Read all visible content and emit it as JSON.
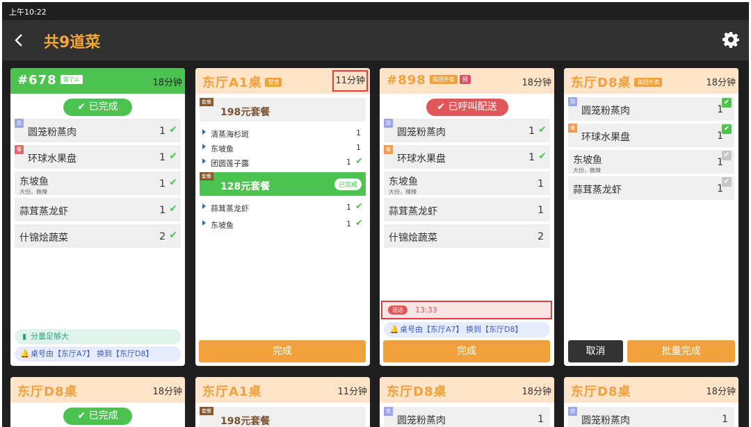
{
  "status_time": "上午10:22",
  "title": "共9道菜",
  "cards": [
    {
      "title": "#678",
      "tag": "饿了么",
      "time": "18分钟",
      "status": "已完成",
      "items": [
        {
          "badge": "追",
          "name": "圆笼粉蒸肉",
          "qty": "1"
        },
        {
          "badge": "催",
          "name": "环球水果盘",
          "qty": "1"
        },
        {
          "name": "东坡鱼",
          "sub": "大份，微辣",
          "qty": "1"
        },
        {
          "name": "蒜茸蒸龙虾",
          "qty": "1"
        },
        {
          "name": "什锦烩蔬菜",
          "qty": "2"
        }
      ],
      "notes": [
        "分量足够大",
        "桌号由【东厅A7】 换到【东厅D8】"
      ]
    },
    {
      "title": "东厅A1桌",
      "tag": "堂食",
      "time": "11分钟",
      "set1": {
        "tag": "套餐",
        "name": "198元套餐",
        "items": [
          {
            "name": "清蒸海杉斑",
            "qty": "1"
          },
          {
            "name": "东坡鱼",
            "qty": "1"
          },
          {
            "name": "团圆莲子露",
            "qty": "1"
          }
        ]
      },
      "set2": {
        "tag": "套餐",
        "name": "128元套餐",
        "done": "已完成",
        "items": [
          {
            "name": "蒜茸蒸龙虾",
            "qty": "1"
          },
          {
            "name": "东坡鱼",
            "qty": "1"
          }
        ]
      },
      "button": "完成"
    },
    {
      "title": "#898",
      "tag": "美团外卖",
      "tag2": "预",
      "time": "18分钟",
      "status": "已呼叫配送",
      "items": [
        {
          "badge": "加",
          "name": "圆笼粉蒸肉",
          "qty": "1"
        },
        {
          "badge": "催",
          "name": "环球水果盘",
          "qty": "1"
        },
        {
          "name": "东坡鱼",
          "sub": "大份，辣辣",
          "qty": "1"
        },
        {
          "name": "蒜茸蒸龙虾",
          "qty": "1"
        },
        {
          "name": "什锦烩蔬菜",
          "qty": "2"
        }
      ],
      "deliver_tag": "送达",
      "deliver_time": "13:33",
      "note": "桌号由【东厅A7】 换到【东厅D8】",
      "button": "完成"
    },
    {
      "title": "东厅D8桌",
      "tag": "美团外卖",
      "time": "18分钟",
      "items": [
        {
          "badge": "加",
          "name": "圆笼粉蒸肉",
          "qty": "1"
        },
        {
          "badge": "催",
          "name": "环球水果盘",
          "qty": "1"
        },
        {
          "name": "东坡鱼",
          "sub": "大份，微辣",
          "qty": "1"
        },
        {
          "name": "蒜茸蒸龙虾",
          "qty": "1"
        }
      ],
      "cancel": "取消",
      "batch": "批量完成"
    },
    {
      "title": "东厅D8桌",
      "time": "18分钟",
      "status": "已完成"
    },
    {
      "title": "东厅A1桌",
      "time": "11分钟",
      "set_tag": "套餐",
      "set_name": "198元套餐"
    },
    {
      "title": "东厅D8桌",
      "time": "18分钟",
      "badge": "追",
      "item": "圆笼粉蒸肉",
      "qty": "1"
    },
    {
      "title": "东厅D8桌",
      "time": "18分钟",
      "badge": "追",
      "item": "圆笼粉蒸肉",
      "qty": "1"
    }
  ]
}
